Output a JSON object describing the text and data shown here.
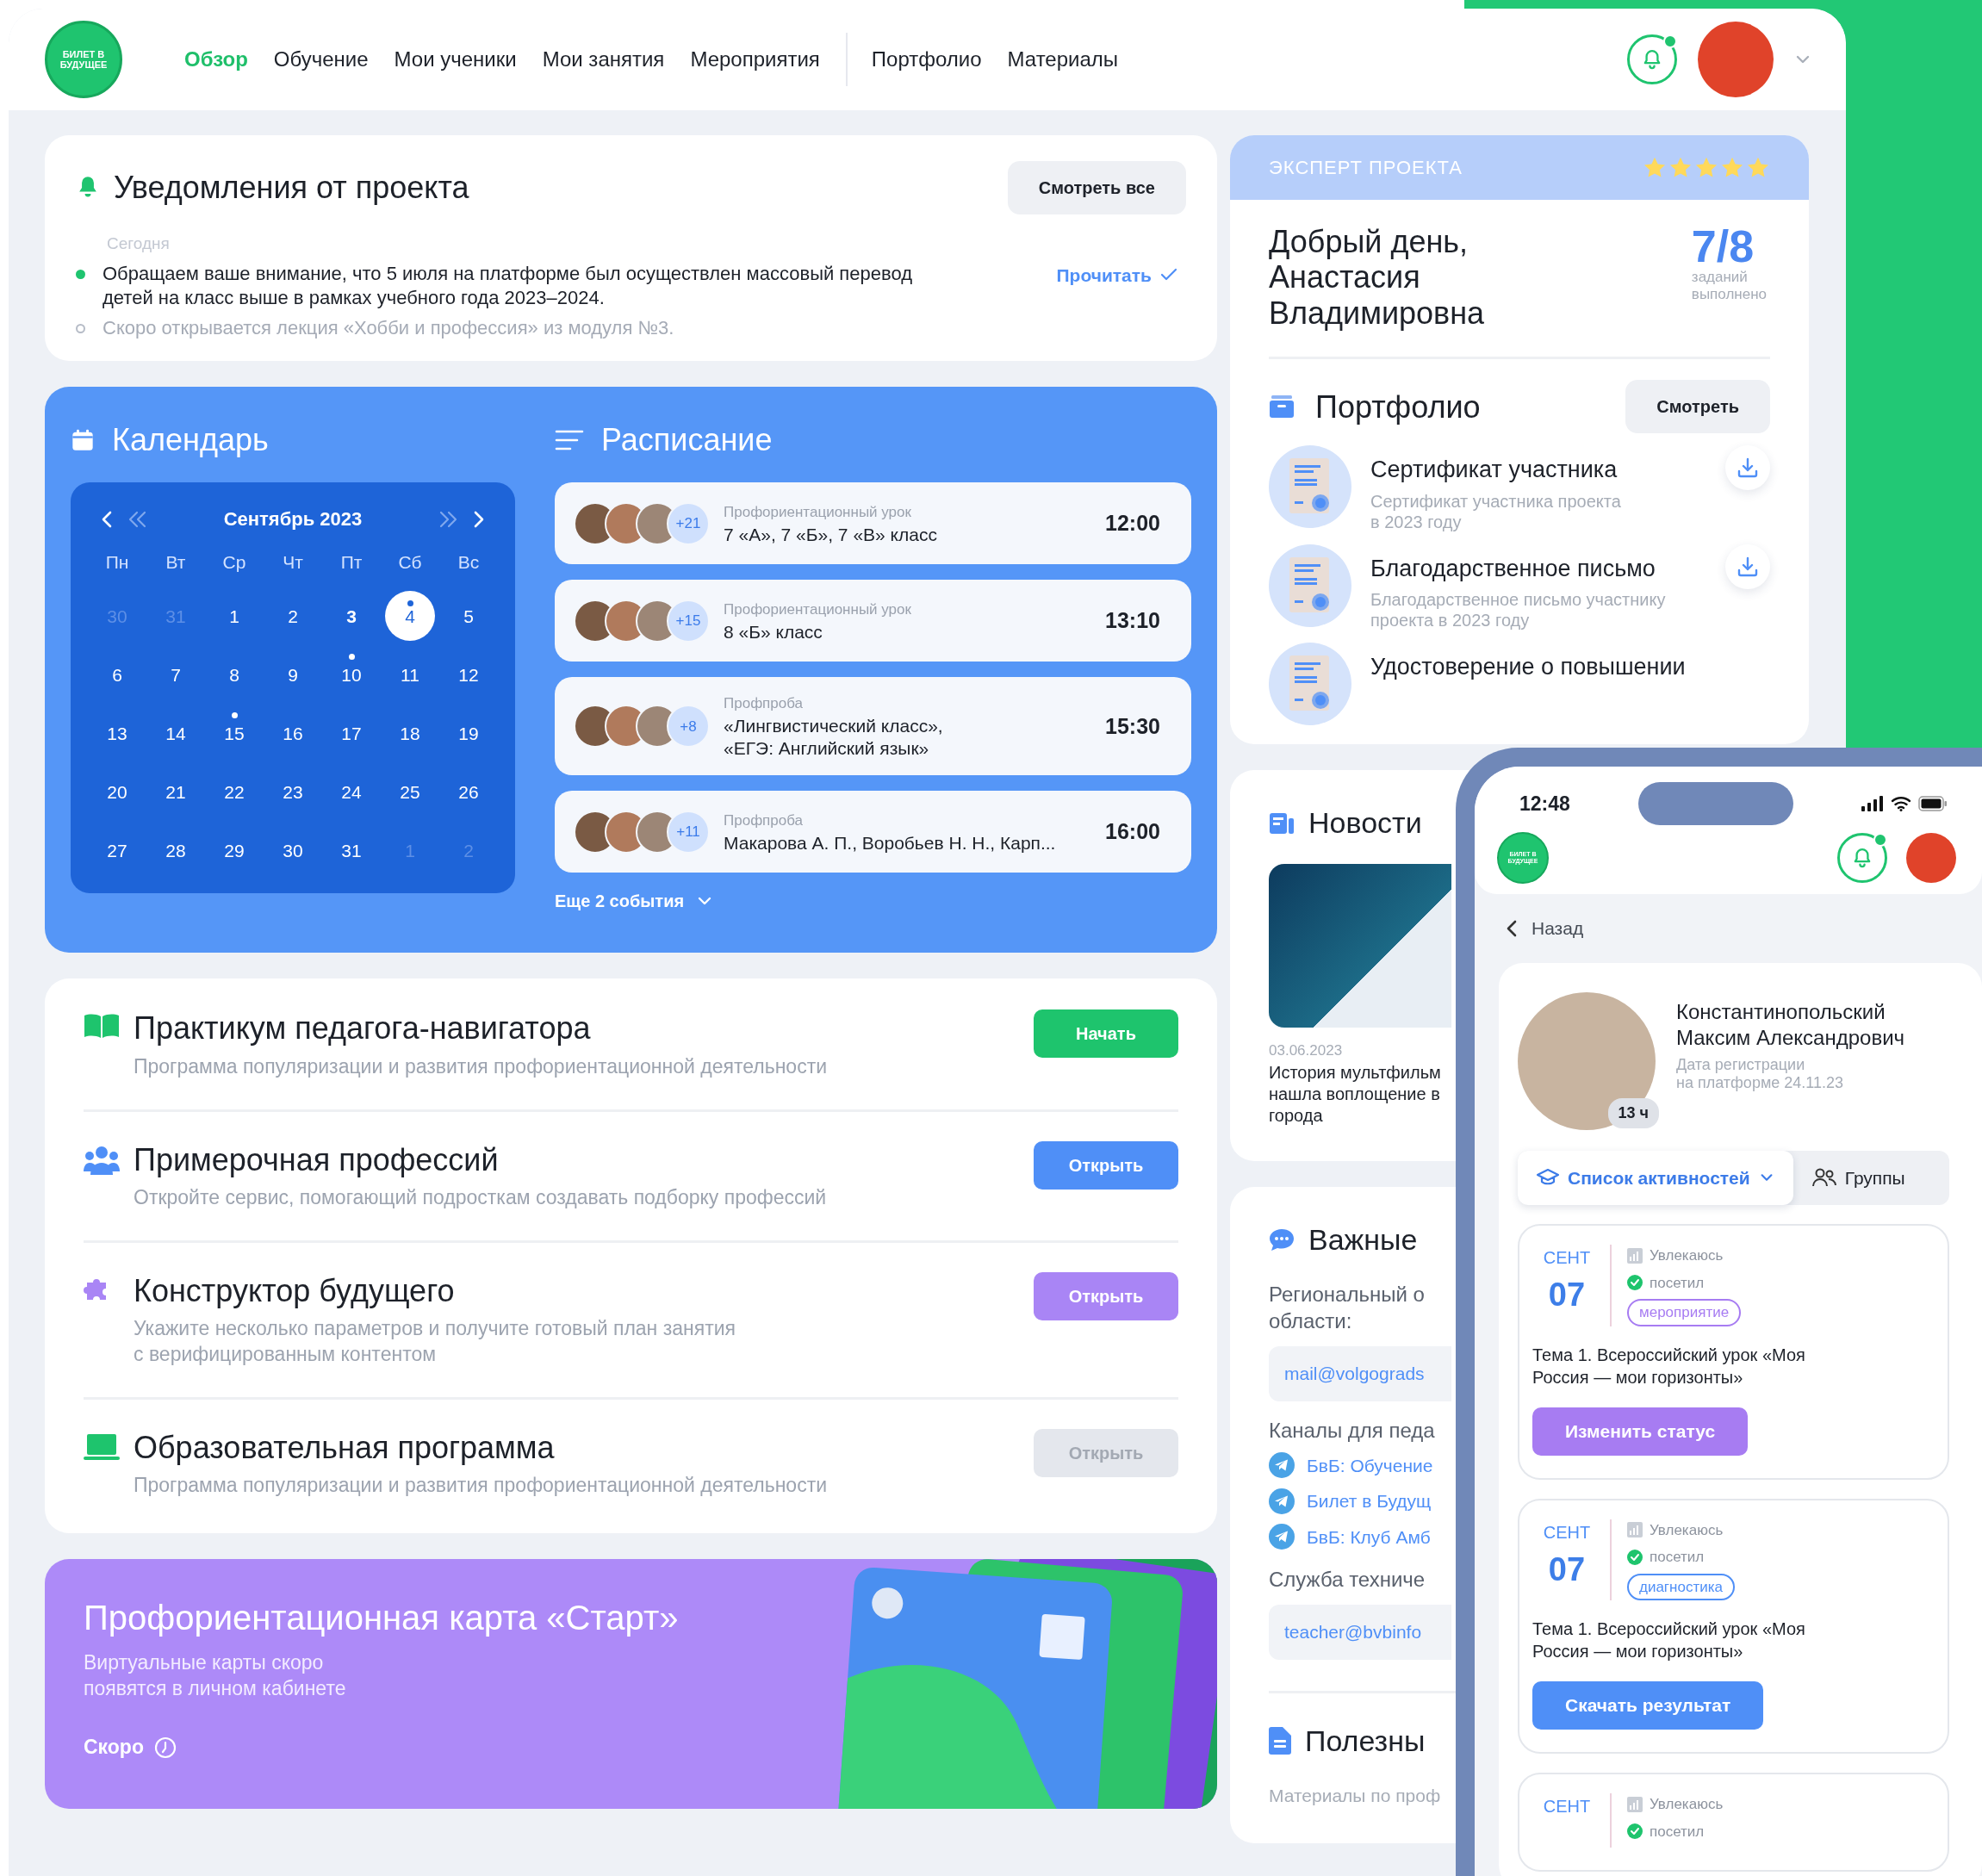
{
  "nav": {
    "logo_text": "БИЛЕТ В БУДУЩЕЕ",
    "items": [
      {
        "label": "Обзор",
        "selected": true
      },
      {
        "label": "Обучение",
        "selected": false
      },
      {
        "label": "Мои ученики",
        "selected": false
      },
      {
        "label": "Мои занятия",
        "selected": false
      },
      {
        "label": "Мероприятия",
        "selected": false
      }
    ],
    "items_secondary": [
      {
        "label": "Портфолио",
        "selected": false
      },
      {
        "label": "Материалы",
        "selected": false
      }
    ],
    "notifications_unread": true
  },
  "notifications": {
    "title": "Уведомления от проекта",
    "button": "Смотреть все",
    "date_label": "Сегодня",
    "items": [
      {
        "text": "Обращаем ваше внимание, что 5 июля на платформе был осуществлен массовый перевод детей на класс выше в рамках учебного года 2023–2024.",
        "unread": true,
        "action": "Прочитать"
      },
      {
        "text": "Скоро открывается лекция «Хобби и профессия» из модуля №3.",
        "unread": false
      }
    ]
  },
  "calendar": {
    "title": "Календарь",
    "month": "Сентябрь 2023",
    "weekdays": [
      "Пн",
      "Вт",
      "Ср",
      "Чт",
      "Пт",
      "Сб",
      "Вс"
    ],
    "days": [
      {
        "day": "30",
        "outside": true,
        "today": false,
        "selected": false,
        "event": false
      },
      {
        "day": "31",
        "outside": true,
        "today": false,
        "selected": false,
        "event": false
      },
      {
        "day": "1",
        "outside": false,
        "today": false,
        "selected": false,
        "event": false
      },
      {
        "day": "2",
        "outside": false,
        "today": false,
        "selected": false,
        "event": false
      },
      {
        "day": "3",
        "outside": false,
        "today": true,
        "selected": false,
        "event": false
      },
      {
        "day": "4",
        "outside": false,
        "today": false,
        "selected": true,
        "event": true
      },
      {
        "day": "5",
        "outside": false,
        "today": false,
        "selected": false,
        "event": false
      },
      {
        "day": "6",
        "outside": false,
        "today": false,
        "selected": false,
        "event": false
      },
      {
        "day": "7",
        "outside": false,
        "today": false,
        "selected": false,
        "event": false
      },
      {
        "day": "8",
        "outside": false,
        "today": false,
        "selected": false,
        "event": false
      },
      {
        "day": "9",
        "outside": false,
        "today": false,
        "selected": false,
        "event": false
      },
      {
        "day": "10",
        "outside": false,
        "today": false,
        "selected": false,
        "event": true
      },
      {
        "day": "11",
        "outside": false,
        "today": false,
        "selected": false,
        "event": false
      },
      {
        "day": "12",
        "outside": false,
        "today": false,
        "selected": false,
        "event": false
      },
      {
        "day": "13",
        "outside": false,
        "today": false,
        "selected": false,
        "event": false
      },
      {
        "day": "14",
        "outside": false,
        "today": false,
        "selected": false,
        "event": false
      },
      {
        "day": "15",
        "outside": false,
        "today": false,
        "selected": false,
        "event": true
      },
      {
        "day": "16",
        "outside": false,
        "today": false,
        "selected": false,
        "event": false
      },
      {
        "day": "17",
        "outside": false,
        "today": false,
        "selected": false,
        "event": false
      },
      {
        "day": "18",
        "outside": false,
        "today": false,
        "selected": false,
        "event": false
      },
      {
        "day": "19",
        "outside": false,
        "today": false,
        "selected": false,
        "event": false
      },
      {
        "day": "20",
        "outside": false,
        "today": false,
        "selected": false,
        "event": false
      },
      {
        "day": "21",
        "outside": false,
        "today": false,
        "selected": false,
        "event": false
      },
      {
        "day": "22",
        "outside": false,
        "today": false,
        "selected": false,
        "event": false
      },
      {
        "day": "23",
        "outside": false,
        "today": false,
        "selected": false,
        "event": false
      },
      {
        "day": "24",
        "outside": false,
        "today": false,
        "selected": false,
        "event": false
      },
      {
        "day": "25",
        "outside": false,
        "today": false,
        "selected": false,
        "event": false
      },
      {
        "day": "26",
        "outside": false,
        "today": false,
        "selected": false,
        "event": false
      },
      {
        "day": "27",
        "outside": false,
        "today": false,
        "selected": false,
        "event": false
      },
      {
        "day": "28",
        "outside": false,
        "today": false,
        "selected": false,
        "event": false
      },
      {
        "day": "29",
        "outside": false,
        "today": false,
        "selected": false,
        "event": false
      },
      {
        "day": "30",
        "outside": false,
        "today": false,
        "selected": false,
        "event": false
      },
      {
        "day": "31",
        "outside": false,
        "today": false,
        "selected": false,
        "event": false
      },
      {
        "day": "1",
        "outside": true,
        "today": false,
        "selected": false,
        "event": false
      },
      {
        "day": "2",
        "outside": true,
        "today": false,
        "selected": false,
        "event": false
      }
    ]
  },
  "schedule": {
    "title": "Расписание",
    "events": [
      {
        "type": "Профориентационный урок",
        "title": "7 «А», 7 «Б», 7 «В» класс",
        "extra": "+21",
        "time": "12:00"
      },
      {
        "type": "Профориентационный урок",
        "title": "8 «Б» класс",
        "extra": "+15",
        "time": "13:10"
      },
      {
        "type": "Профпроба",
        "title": "«Лингвистический класс»,\n«ЕГЭ: Английский язык»",
        "extra": "+8",
        "time": "15:30"
      },
      {
        "type": "Профпроба",
        "title": "Макарова А. П., Воробьев Н. Н., Карп...",
        "extra": "+11",
        "time": "16:00"
      }
    ],
    "more": "Еще 2 события"
  },
  "tools": [
    {
      "kind": "book",
      "title": "Практикум педагога-навигатора",
      "description": "Программа популяризации и развития профориентационной деятельности",
      "button": "Начать",
      "color": "#1ec46d",
      "disabled": false
    },
    {
      "kind": "people",
      "title": "Примерочная профессий",
      "description": "Откройте сервис, помогающий подросткам создавать подборку профессий",
      "button": "Открыть",
      "color": "#4f8ff7",
      "disabled": false
    },
    {
      "kind": "puzzle",
      "title": "Конструктор будущего",
      "description": "Укажите несколько параметров и получите готовый план занятия\nс верифицированным контентом",
      "button": "Открыть",
      "color": "#a985f5",
      "disabled": false
    },
    {
      "kind": "laptop",
      "title": "Образовательная программа",
      "description": "Программа популяризации и развития профориентационной деятельности",
      "button": "Открыть",
      "color": "#e4e7ed",
      "disabled": true
    }
  ],
  "promo": {
    "title": "Профориентационная карта «Старт»",
    "text": "Виртуальные карты скоро\nпоявятся в личном кабинете",
    "status": "Скоро"
  },
  "expert": {
    "label": "ЭКСПЕРТ ПРОЕКТА",
    "stars": 5,
    "greeting": "Добрый день,\nАнастасия\nВладимировна",
    "score": "7/8",
    "score_caption": "заданий\nвыполнено"
  },
  "portfolio": {
    "title": "Портфолио",
    "button": "Смотреть",
    "items": [
      {
        "title": "Сертификат участника",
        "description": "Сертификат участника проекта\nв 2023 году"
      },
      {
        "title": "Благодарственное письмо",
        "description": "Благодарственное письмо участнику\nпроекта в 2023 году"
      },
      {
        "title": "Удостоверение о повышении"
      }
    ]
  },
  "news": {
    "title": "Новости",
    "date": "03.06.2023",
    "text_lines": [
      "История мультфильм",
      "нашла воплощение в",
      "города"
    ]
  },
  "contacts": {
    "title": "Важные",
    "regional_label_lines": [
      "Региональный о",
      "области:"
    ],
    "regional_email": "mail@volgograds",
    "channels_label": "Каналы для педа",
    "channels": [
      "БвБ: Обучение",
      "Билет в Будущ",
      "БвБ: Клуб Амб"
    ],
    "support_label": "Служба техниче",
    "support_email": "teacher@bvbinfo"
  },
  "useful": {
    "title": "Полезны",
    "text": "Материалы по проф"
  },
  "phone": {
    "time": "12:48",
    "logo_text": "БИЛЕТ В БУДУЩЕЕ",
    "notifications_unread": true,
    "back": "Назад",
    "student": {
      "name": "Константинопольский\nМаксим Александрович",
      "registered": "Дата регистрации\nна платформе 24.11.23",
      "hours": "13 ч"
    },
    "tabs": [
      {
        "label": "Список активностей",
        "selected": true,
        "kind": "cap"
      },
      {
        "label": "Группы",
        "selected": false,
        "kind": "people"
      }
    ],
    "activities": [
      {
        "month": "СЕНТ",
        "day": "07",
        "interest": "Увлекаюсь",
        "status": "посетил",
        "tag": "мероприятие",
        "color": "#a77cf2",
        "title": "Тема 1. Всероссийский урок «Моя Россия — мои горизонты»",
        "button": "Изменить статус"
      },
      {
        "month": "СЕНТ",
        "day": "07",
        "interest": "Увлекаюсь",
        "status": "посетил",
        "tag": "диагностика",
        "color": "#4f8ff7",
        "title": "Тема 1. Всероссийский урок «Моя Россия — мои горизонты»",
        "button": "Скачать результат"
      },
      {
        "month": "СЕНТ",
        "interest": "Увлекаюсь",
        "status": "посетил"
      }
    ]
  }
}
